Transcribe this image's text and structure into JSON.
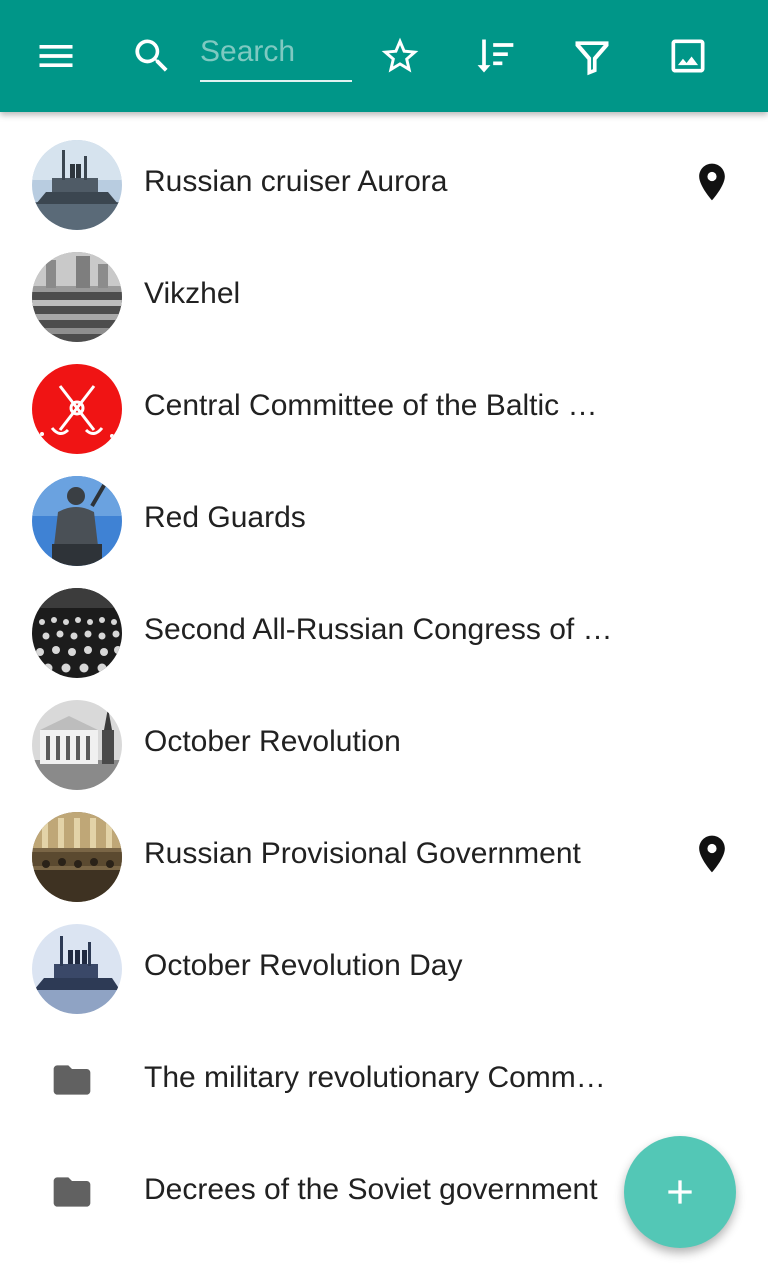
{
  "toolbar": {
    "search_placeholder": "Search",
    "search_value": "",
    "icons": [
      "menu-icon",
      "search-icon",
      "star-outline-icon",
      "sort-icon",
      "filter-icon",
      "image-icon"
    ],
    "background": "#009688"
  },
  "items": [
    {
      "label": "Russian cruiser Aurora",
      "thumb": "photo",
      "location": true
    },
    {
      "label": "Vikzhel",
      "thumb": "photo",
      "location": false
    },
    {
      "label": "Central Committee of the Baltic …",
      "thumb": "photo",
      "location": false
    },
    {
      "label": "Red Guards",
      "thumb": "photo",
      "location": false
    },
    {
      "label": "Second All-Russian Congress of …",
      "thumb": "photo",
      "location": false
    },
    {
      "label": "October Revolution",
      "thumb": "photo",
      "location": false
    },
    {
      "label": "Russian Provisional Government",
      "thumb": "photo",
      "location": true
    },
    {
      "label": "October Revolution Day",
      "thumb": "photo",
      "location": false
    },
    {
      "label": "The military revolutionary Comm…",
      "thumb": "folder-icon",
      "location": false
    },
    {
      "label": "Decrees of the Soviet government",
      "thumb": "folder-icon",
      "location": false
    }
  ],
  "fab": {
    "icon": "plus-icon",
    "color": "#53c7b6"
  }
}
